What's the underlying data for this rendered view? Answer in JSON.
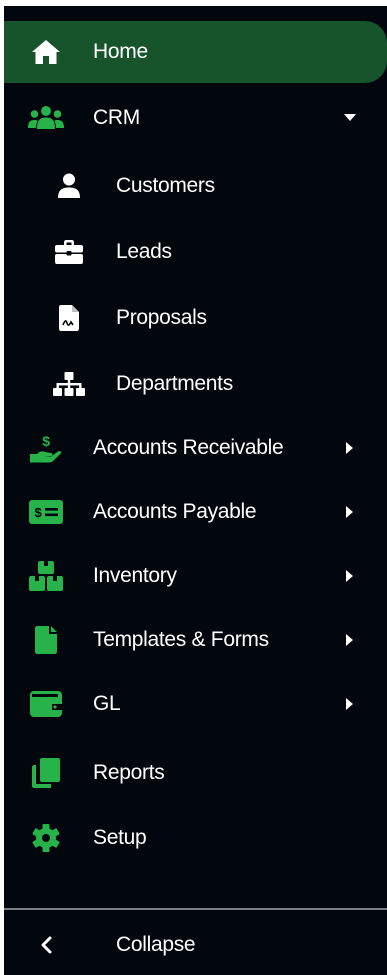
{
  "colors": {
    "sidebar_bg": "#01070d",
    "active_bg": "#17542c",
    "accent_green": "#27b34a",
    "text": "#ffffff"
  },
  "menu": {
    "home": {
      "label": "Home",
      "icon": "home-icon"
    },
    "crm": {
      "label": "CRM",
      "icon": "users-icon",
      "expanded": true,
      "children": [
        {
          "label": "Customers",
          "icon": "user-icon"
        },
        {
          "label": "Leads",
          "icon": "briefcase-icon"
        },
        {
          "label": "Proposals",
          "icon": "file-signature-icon"
        },
        {
          "label": "Departments",
          "icon": "sitemap-icon"
        }
      ]
    },
    "items": [
      {
        "label": "Accounts Receivable",
        "icon": "hand-dollar-icon"
      },
      {
        "label": "Accounts Payable",
        "icon": "money-bill-icon"
      },
      {
        "label": "Inventory",
        "icon": "boxes-icon"
      },
      {
        "label": "Templates & Forms",
        "icon": "file-icon"
      },
      {
        "label": "GL",
        "icon": "wallet-icon"
      },
      {
        "label": "Reports",
        "icon": "copy-icon"
      },
      {
        "label": "Setup",
        "icon": "gear-icon"
      }
    ]
  },
  "footer": {
    "collapse_label": "Collapse",
    "icon": "chevron-left-icon"
  }
}
